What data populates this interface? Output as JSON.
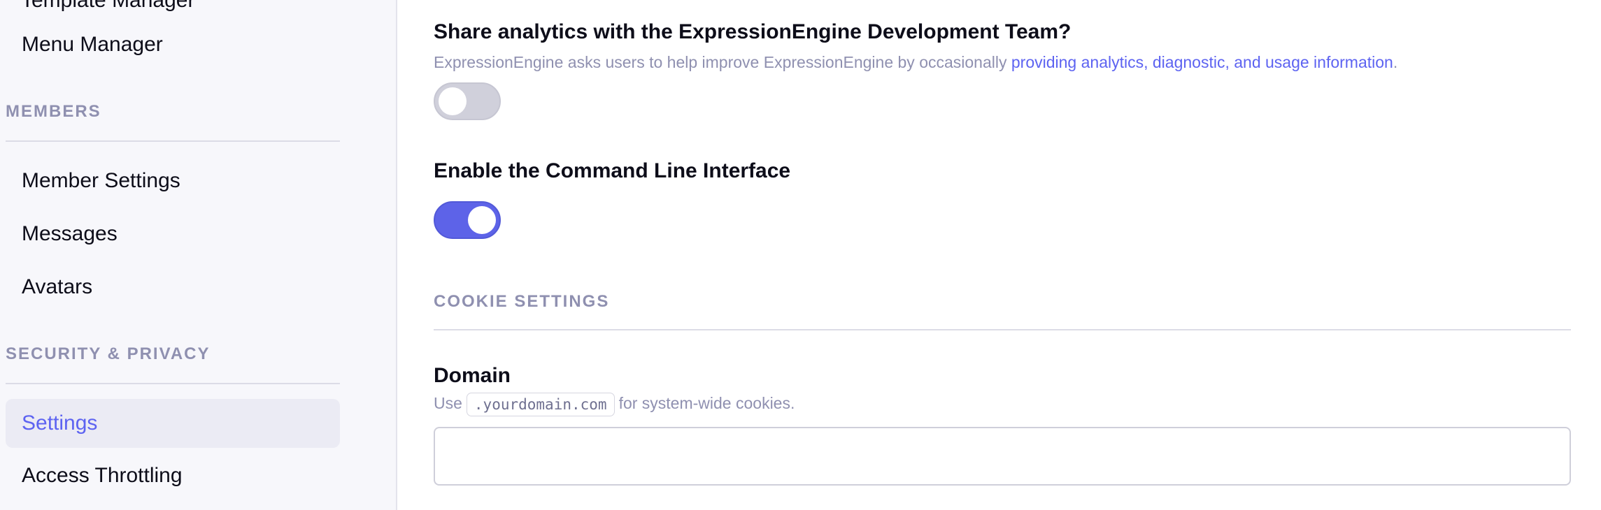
{
  "sidebar": {
    "cut_item_label": "Template Manager",
    "menu_manager": "Menu Manager",
    "members_heading": "MEMBERS",
    "member_settings": "Member Settings",
    "messages": "Messages",
    "avatars": "Avatars",
    "security_heading": "SECURITY & PRIVACY",
    "settings": "Settings",
    "access_throttling": "Access Throttling"
  },
  "main": {
    "analytics": {
      "title": "Share analytics with the ExpressionEngine Development Team?",
      "desc_prefix": "ExpressionEngine asks users to help improve ExpressionEngine by occasionally ",
      "desc_link": "providing analytics, diagnostic, and usage information",
      "desc_suffix": ".",
      "enabled": false
    },
    "cli": {
      "title": "Enable the Command Line Interface",
      "enabled": true
    },
    "cookie_section_heading": "COOKIE SETTINGS",
    "domain": {
      "title": "Domain",
      "desc_prefix": "Use",
      "code": ".yourdomain.com",
      "desc_suffix": "for system-wide cookies.",
      "value": ""
    }
  },
  "colors": {
    "accent": "#5d63f1",
    "muted_text": "#8f90b0",
    "sidebar_bg": "#f7f7fb"
  },
  "icons": []
}
